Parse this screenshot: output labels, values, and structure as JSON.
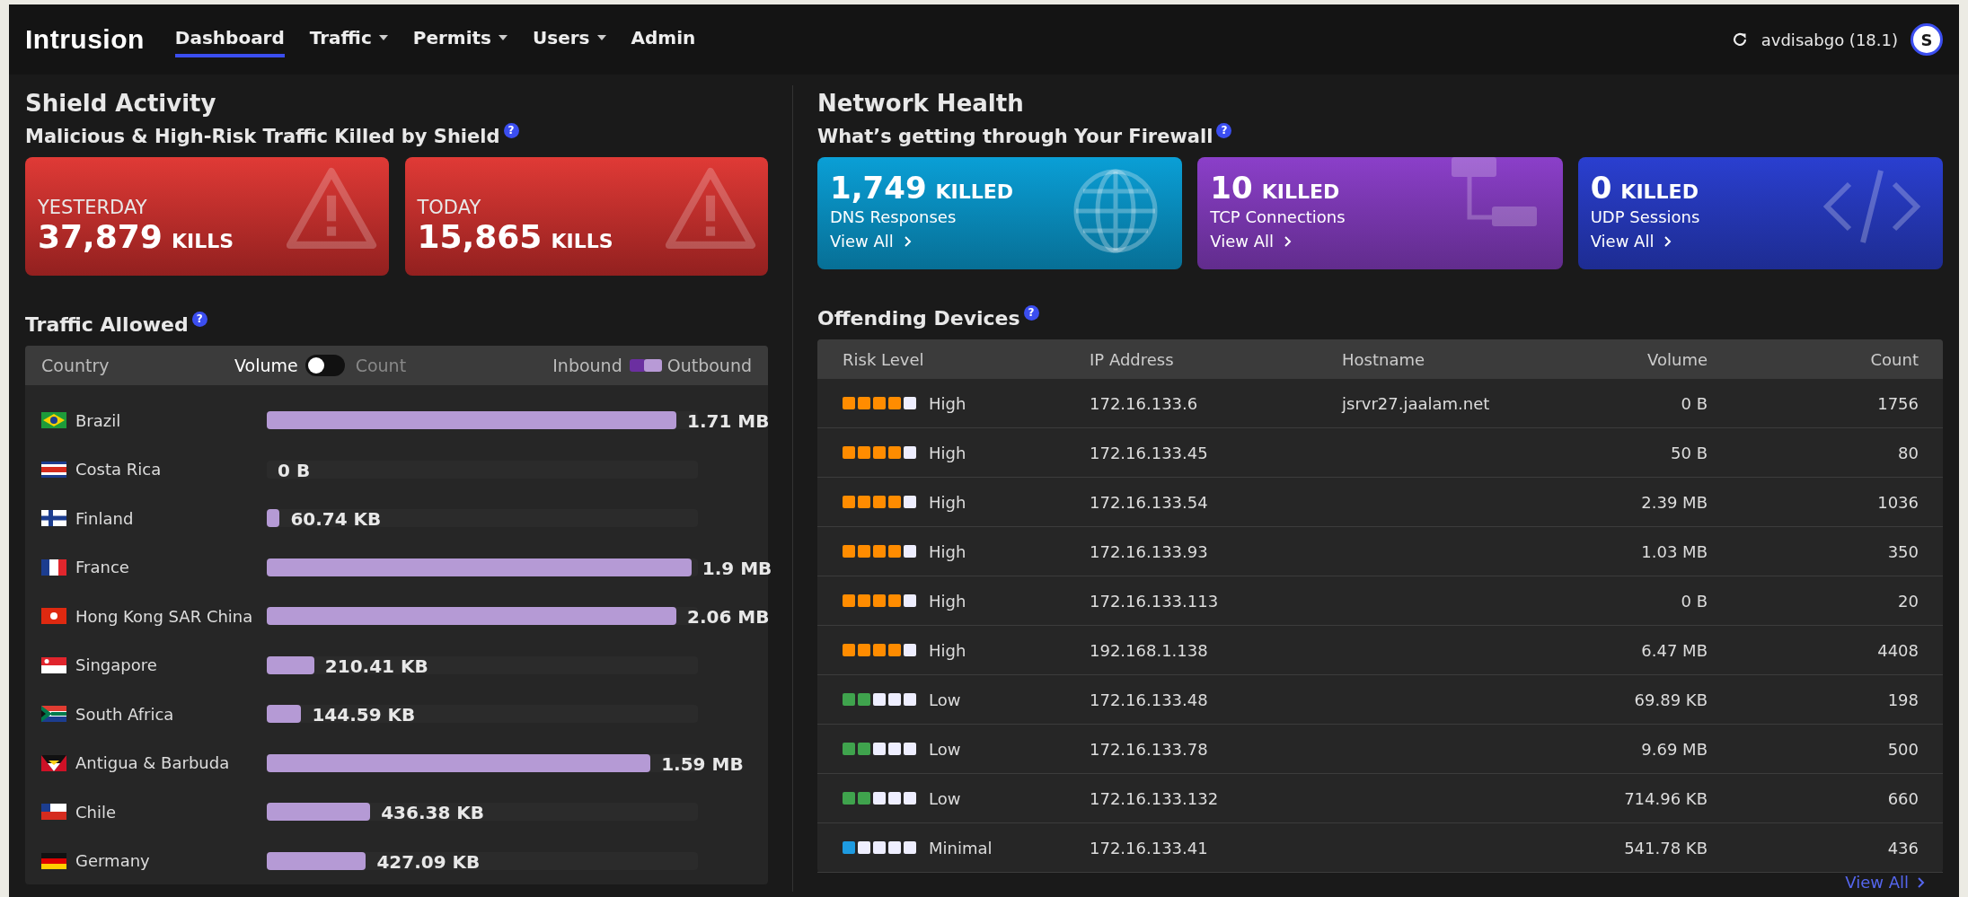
{
  "brand": "Intrusion",
  "nav": [
    {
      "label": "Dashboard",
      "selected": true,
      "has_menu": false
    },
    {
      "label": "Traffic",
      "selected": false,
      "has_menu": true
    },
    {
      "label": "Permits",
      "selected": false,
      "has_menu": true
    },
    {
      "label": "Users",
      "selected": false,
      "has_menu": true
    },
    {
      "label": "Admin",
      "selected": false,
      "has_menu": false
    }
  ],
  "user": {
    "name": "avdisabgo (18.1)",
    "avatar": "S"
  },
  "shield": {
    "title": "Shield Activity",
    "subtitle": "Malicious & High-Risk Traffic Killed by Shield",
    "help": "?",
    "cards": [
      {
        "period": "YESTERDAY",
        "count": "37,879",
        "unit": "KILLS"
      },
      {
        "period": "TODAY",
        "count": "15,865",
        "unit": "KILLS"
      }
    ]
  },
  "traffic": {
    "title": "Traffic Allowed",
    "help": "?",
    "column": "Country",
    "toggle": {
      "left": "Volume",
      "right": "Count",
      "on": false
    },
    "legend": {
      "inbound": "Inbound",
      "outbound": "Outbound"
    },
    "rows": [
      {
        "country": "Brazil",
        "value": "1.71 MB",
        "level": 0.95
      },
      {
        "country": "Costa Rica",
        "value": "0 B",
        "level": 0
      },
      {
        "country": "Finland",
        "value": "60.74 KB",
        "level": 0.03
      },
      {
        "country": "France",
        "value": "1.9 MB",
        "level": 0.985
      },
      {
        "country": "Hong Kong SAR China",
        "value": "2.06 MB",
        "level": 0.95
      },
      {
        "country": "Singapore",
        "value": "210.41 KB",
        "level": 0.11
      },
      {
        "country": "South Africa",
        "value": "144.59 KB",
        "level": 0.08
      },
      {
        "country": "Antigua & Barbuda",
        "value": "1.59 MB",
        "level": 0.89
      },
      {
        "country": "Chile",
        "value": "436.38 KB",
        "level": 0.24
      },
      {
        "country": "Germany",
        "value": "427.09 KB",
        "level": 0.23
      }
    ]
  },
  "network": {
    "title": "Network Health",
    "subtitle": "What’s getting through Your Firewall",
    "help": "?",
    "cards": [
      {
        "count": "1,749",
        "unit": "KILLED",
        "label": "DNS Responses",
        "link": "View All",
        "color": "#0a9fd6"
      },
      {
        "count": "10",
        "unit": "KILLED",
        "label": "TCP Connections",
        "link": "View All",
        "color": "#8b3fc9"
      },
      {
        "count": "0",
        "unit": "KILLED",
        "label": "UDP Sessions",
        "link": "View All",
        "color": "#2a3fd0"
      }
    ]
  },
  "devices": {
    "title": "Offending Devices",
    "help": "?",
    "columns": [
      "Risk Level",
      "IP Address",
      "Hostname",
      "Volume",
      "Count"
    ],
    "rows": [
      {
        "risk": "High",
        "stars": 4,
        "color": "#ff8c00",
        "ip": "172.16.133.6",
        "hostname": "jsrvr27.jaalam.net",
        "volume": "0 B",
        "count": "1756"
      },
      {
        "risk": "High",
        "stars": 4,
        "color": "#ff8c00",
        "ip": "172.16.133.45",
        "volume": "50 B",
        "count": "80"
      },
      {
        "risk": "High",
        "stars": 4,
        "color": "#ff8c00",
        "ip": "172.16.133.54",
        "volume": "2.39 MB",
        "count": "1036"
      },
      {
        "risk": "High",
        "stars": 4,
        "color": "#ff8c00",
        "ip": "172.16.133.93",
        "volume": "1.03 MB",
        "count": "350"
      },
      {
        "risk": "High",
        "stars": 4,
        "color": "#ff8c00",
        "ip": "172.16.133.113",
        "volume": "0 B",
        "count": "20"
      },
      {
        "risk": "High",
        "stars": 4,
        "color": "#ff8c00",
        "ip": "192.168.1.138",
        "volume": "6.47 MB",
        "count": "4408"
      },
      {
        "risk": "Low",
        "stars": 2,
        "color": "#3fa34d",
        "ip": "172.16.133.48",
        "volume": "69.89 KB",
        "count": "198"
      },
      {
        "risk": "Low",
        "stars": 2,
        "color": "#3fa34d",
        "ip": "172.16.133.78",
        "volume": "9.69 MB",
        "count": "500"
      },
      {
        "risk": "Low",
        "stars": 2,
        "color": "#3fa34d",
        "ip": "172.16.133.132",
        "volume": "714.96 KB",
        "count": "660"
      },
      {
        "risk": "Minimal",
        "stars": 1,
        "color": "#1e9be0",
        "ip": "172.16.133.41",
        "volume": "541.78 KB",
        "count": "436"
      }
    ],
    "link": "View All"
  }
}
